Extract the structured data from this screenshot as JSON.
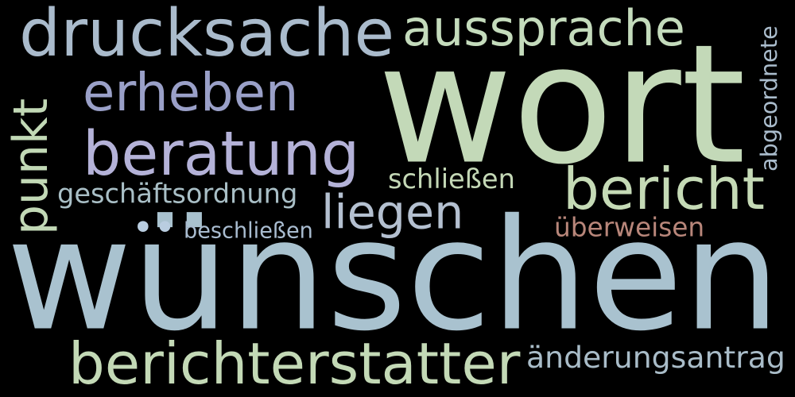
{
  "words": [
    {
      "text": "wünschen",
      "color": "#a9c2cf"
    },
    {
      "text": "wort",
      "color": "#c3d9b8"
    },
    {
      "text": "drucksache",
      "color": "#aabbcc"
    },
    {
      "text": "aussprache",
      "color": "#c4dbbc"
    },
    {
      "text": "erheben",
      "color": "#9aa0c8"
    },
    {
      "text": "beratung",
      "color": "#b4b2d8"
    },
    {
      "text": "punkt",
      "color": "#c2d9b6"
    },
    {
      "text": "bericht",
      "color": "#c5dab6"
    },
    {
      "text": "berichterstatter",
      "color": "#c3d9b6"
    },
    {
      "text": "änderungsantrag",
      "color": "#a9bcc8"
    },
    {
      "text": "liegen",
      "color": "#b4c0d0"
    },
    {
      "text": "geschäftsordnung",
      "color": "#a9bfc6"
    },
    {
      "text": "schließen",
      "color": "#c4d8b6"
    },
    {
      "text": "überweisen",
      "color": "#b8867a"
    },
    {
      "text": "beschließen",
      "color": "#a9bcd0"
    },
    {
      "text": "abgeordnete",
      "color": "#aabccc"
    },
    {
      "text": "••",
      "color": "#b9cde0"
    }
  ]
}
